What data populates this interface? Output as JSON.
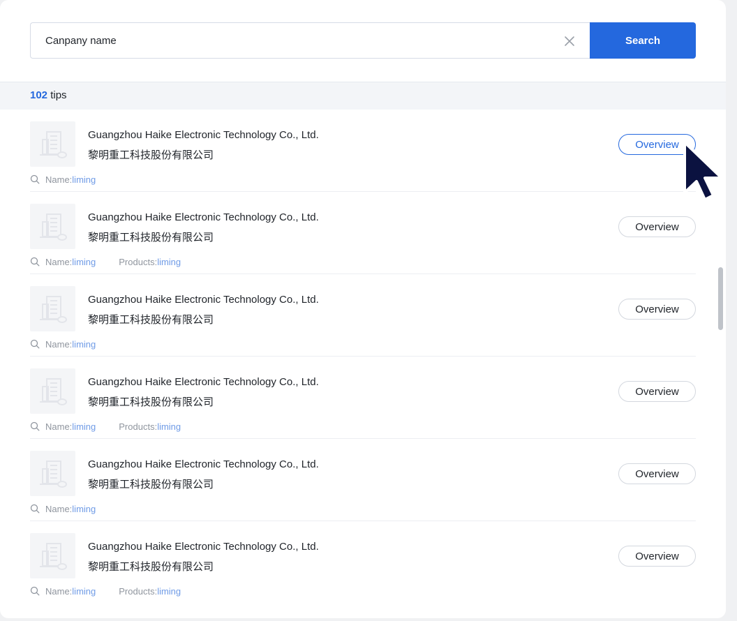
{
  "search": {
    "value": "Canpany name",
    "clear_icon": "close-icon",
    "button_label": "Search"
  },
  "tips": {
    "count": "102",
    "label": " tips"
  },
  "results": [
    {
      "name_en": "Guangzhou Haike Electronic Technology Co., Ltd.",
      "name_cn": "黎明重工科技股份有限公司",
      "name_label": "Name:",
      "name_value": "liming",
      "products_label": "",
      "products_value": "",
      "overview_label": "Overview"
    },
    {
      "name_en": "Guangzhou Haike Electronic Technology Co., Ltd.",
      "name_cn": "黎明重工科技股份有限公司",
      "name_label": "Name:",
      "name_value": "liming",
      "products_label": "Products:",
      "products_value": "liming",
      "overview_label": "Overview"
    },
    {
      "name_en": "Guangzhou Haike Electronic Technology Co., Ltd.",
      "name_cn": "黎明重工科技股份有限公司",
      "name_label": "Name:",
      "name_value": "liming",
      "products_label": "",
      "products_value": "",
      "overview_label": "Overview"
    },
    {
      "name_en": "Guangzhou Haike Electronic Technology Co., Ltd.",
      "name_cn": "黎明重工科技股份有限公司",
      "name_label": "Name:",
      "name_value": "liming",
      "products_label": "Products:",
      "products_value": "liming",
      "overview_label": "Overview"
    },
    {
      "name_en": "Guangzhou Haike Electronic Technology Co., Ltd.",
      "name_cn": "黎明重工科技股份有限公司",
      "name_label": "Name:",
      "name_value": "liming",
      "products_label": "",
      "products_value": "",
      "overview_label": "Overview"
    },
    {
      "name_en": "Guangzhou Haike Electronic Technology Co., Ltd.",
      "name_cn": "黎明重工科技股份有限公司",
      "name_label": "Name:",
      "name_value": "liming",
      "products_label": "Products:",
      "products_value": "liming",
      "overview_label": "Overview"
    }
  ],
  "colors": {
    "accent": "#2468de",
    "highlight_text": "#6f9be6",
    "muted_text": "#8f959e"
  },
  "icons": {
    "logo": "building-icon",
    "meta": "magnifier-icon",
    "pointer": "cursor-arrow-icon"
  }
}
